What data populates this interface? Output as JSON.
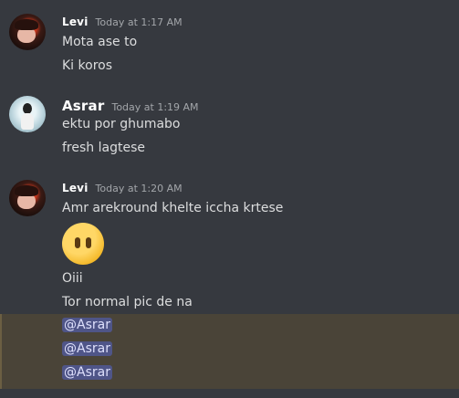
{
  "messages": [
    {
      "author": "Levi",
      "timestamp": "Today at 1:17 AM",
      "lines": [
        "Mota ase to",
        "Ki koros"
      ]
    },
    {
      "author": "Asrar",
      "timestamp": "Today at 1:19 AM",
      "lines": [
        "ektu por ghumabo",
        "fresh lagtese"
      ]
    },
    {
      "author": "Levi",
      "timestamp": "Today at 1:20 AM",
      "lines": [
        "Amr arekround khelte iccha krtese",
        "Oiii",
        "Tor normal pic de na"
      ],
      "emoji": "face-without-mouth-emoji",
      "mentions": [
        "@Asrar",
        "@Asrar",
        "@Asrar"
      ]
    }
  ],
  "colors": {
    "background": "#36393f",
    "mention_bg": "#4f5588",
    "highlight_bg": "#4a4438"
  }
}
